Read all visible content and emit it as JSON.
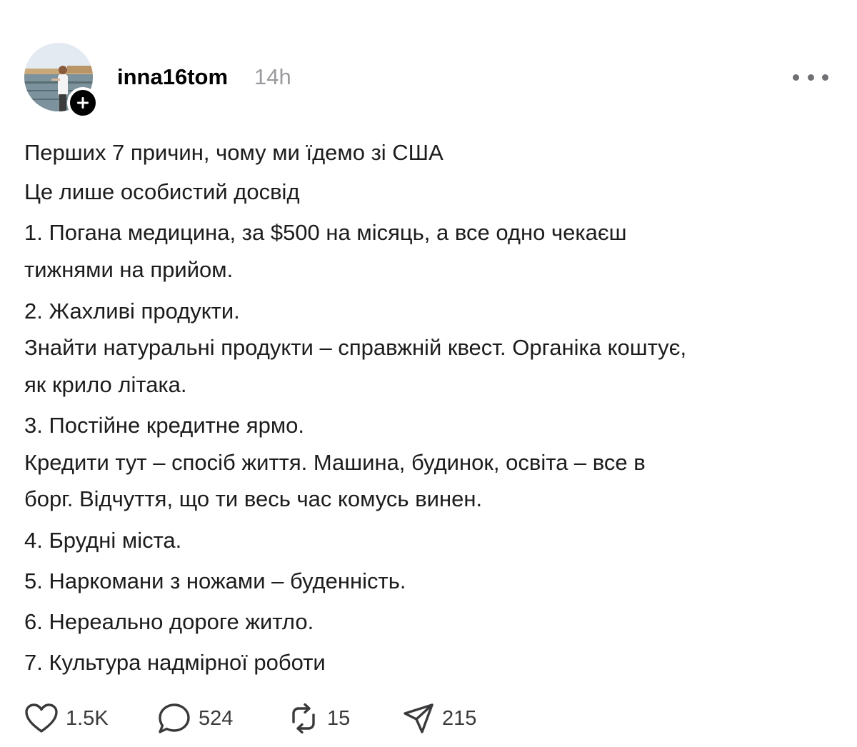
{
  "header": {
    "username": "inna16tom",
    "timestamp": "14h",
    "follow_icon": "plus-icon",
    "more_icon": "ellipsis-icon"
  },
  "post": {
    "lines": [
      "Перших 7 причин, чому ми їдемо зі США",
      "Це лише особистий досвід",
      "1.  Погана медицина, за $500 на місяць, а все одно чекаєш",
      "тижнями на прийом.",
      "2.  Жахливі продукти.",
      "Знайти натуральні продукти – справжній квест. Органіка коштує,",
      "як крило літака.",
      "3.  Постійне кредитне ярмо.",
      "Кредити тут – спосіб життя. Машина, будинок, освіта – все в",
      "борг. Відчуття, що ти весь час комусь винен.",
      "4.  Брудні міста.",
      "5.  Наркомани з ножами – буденність.",
      "6.  Нереально дороге житло.",
      "7.  Культура надмірної роботи"
    ]
  },
  "actions": {
    "likes": "1.5K",
    "comments": "524",
    "reposts": "15",
    "shares": "215"
  },
  "colors": {
    "text": "#1c1c1e",
    "muted": "#9a9a9f",
    "icon": "#3a3a3c",
    "background": "#ffffff"
  }
}
